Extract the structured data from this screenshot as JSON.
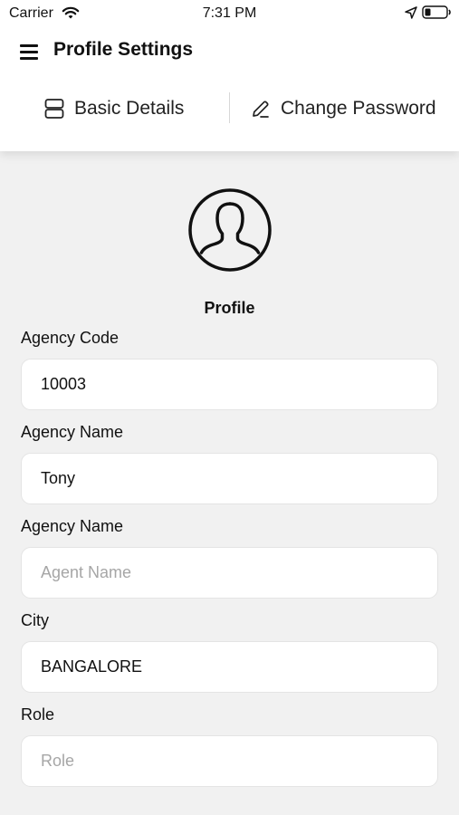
{
  "status_bar": {
    "carrier": "Carrier",
    "time": "7:31 PM"
  },
  "header": {
    "title": "Profile Settings",
    "menu_icon": "hamburger-menu-icon"
  },
  "tabs": [
    {
      "label": "Basic Details",
      "icon": "stack-icon"
    },
    {
      "label": "Change Password",
      "icon": "pencil-icon"
    }
  ],
  "profile": {
    "label": "Profile",
    "avatar_icon": "user-avatar-icon"
  },
  "form": {
    "fields": [
      {
        "label": "Agency Code",
        "value": "10003",
        "placeholder": ""
      },
      {
        "label": "Agency Name",
        "value": "Tony",
        "placeholder": ""
      },
      {
        "label": "Agency Name",
        "value": "",
        "placeholder": "Agent Name"
      },
      {
        "label": "City",
        "value": "BANGALORE",
        "placeholder": ""
      },
      {
        "label": "Role",
        "value": "",
        "placeholder": "Role"
      }
    ]
  },
  "colors": {
    "header_bg": "#ffffff",
    "page_bg": "#f1f1f1",
    "input_bg": "#ffffff",
    "placeholder": "#a6a6a6",
    "text": "#111111"
  }
}
